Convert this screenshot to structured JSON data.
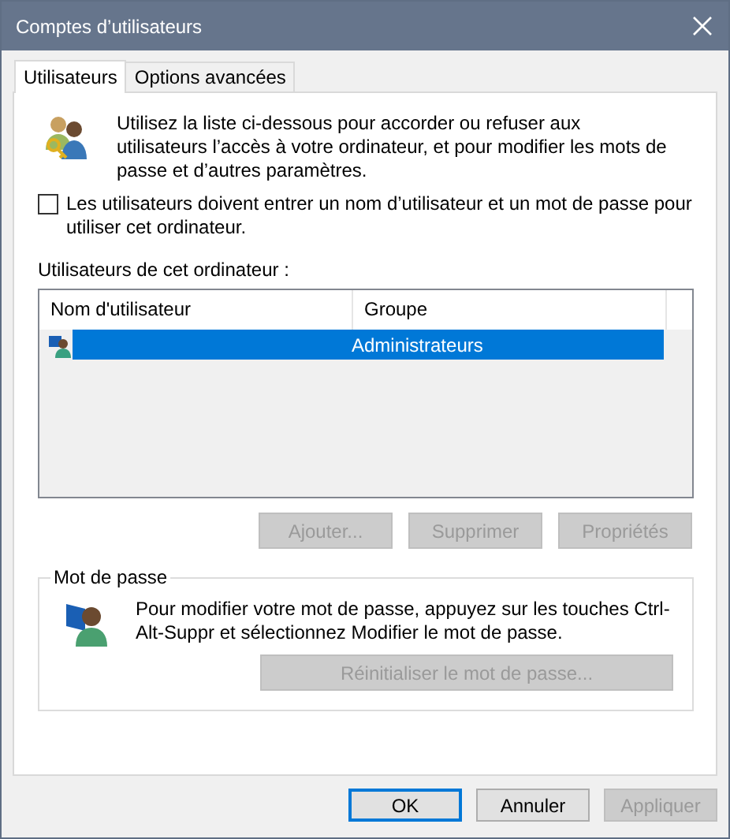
{
  "window": {
    "title": "Comptes d’utilisateurs"
  },
  "tabs": [
    {
      "label": "Utilisateurs",
      "selected": true
    },
    {
      "label": "Options avancées",
      "selected": false
    }
  ],
  "intro": "Utilisez la liste ci-dessous pour accorder ou refuser aux utilisateurs l’accès à votre ordinateur, et pour modifier les mots de passe et d’autres paramètres.",
  "require_login": {
    "label": "Les utilisateurs doivent entrer un nom d’utilisateur et un mot de passe pour utiliser cet ordinateur.",
    "checked": false
  },
  "users": {
    "label": "Utilisateurs de cet ordinateur :",
    "columns": [
      "Nom d'utilisateur",
      "Groupe"
    ],
    "rows": [
      {
        "group": "Administrateurs",
        "selected": true
      }
    ]
  },
  "user_buttons": [
    {
      "label": "Ajouter...",
      "disabled": true
    },
    {
      "label": "Supprimer",
      "disabled": true
    },
    {
      "label": "Propriétés",
      "disabled": true
    }
  ],
  "password": {
    "title": "Mot de passe",
    "text": "Pour modifier votre mot de passe, appuyez sur les touches Ctrl-Alt-Suppr et sélectionnez Modifier le mot de passe.",
    "button": {
      "label": "Réinitialiser le mot de passe...",
      "disabled": true
    }
  },
  "dialog_buttons": [
    {
      "label": "OK",
      "default": true,
      "disabled": false
    },
    {
      "label": "Annuler",
      "default": false,
      "disabled": false
    },
    {
      "label": "Appliquer",
      "default": false,
      "disabled": true
    }
  ]
}
